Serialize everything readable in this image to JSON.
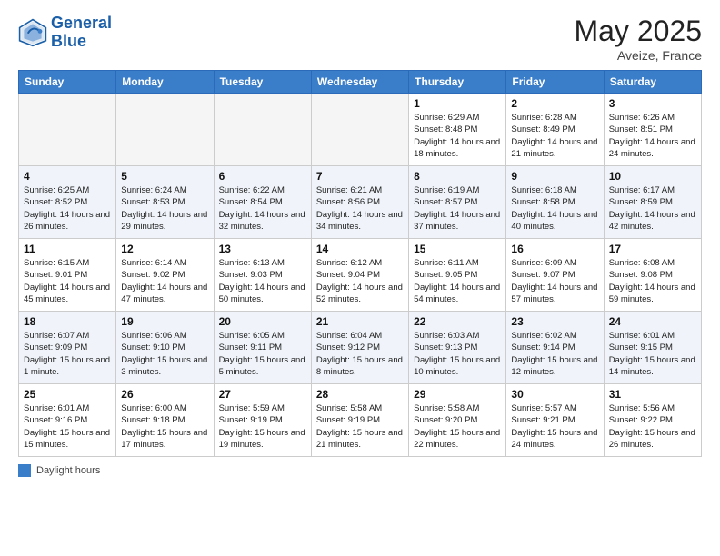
{
  "header": {
    "logo_line1": "General",
    "logo_line2": "Blue",
    "month_title": "May 2025",
    "location": "Aveize, France"
  },
  "days_of_week": [
    "Sunday",
    "Monday",
    "Tuesday",
    "Wednesday",
    "Thursday",
    "Friday",
    "Saturday"
  ],
  "weeks": [
    [
      {
        "day": "",
        "info": ""
      },
      {
        "day": "",
        "info": ""
      },
      {
        "day": "",
        "info": ""
      },
      {
        "day": "",
        "info": ""
      },
      {
        "day": "1",
        "info": "Sunrise: 6:29 AM\nSunset: 8:48 PM\nDaylight: 14 hours and 18 minutes."
      },
      {
        "day": "2",
        "info": "Sunrise: 6:28 AM\nSunset: 8:49 PM\nDaylight: 14 hours and 21 minutes."
      },
      {
        "day": "3",
        "info": "Sunrise: 6:26 AM\nSunset: 8:51 PM\nDaylight: 14 hours and 24 minutes."
      }
    ],
    [
      {
        "day": "4",
        "info": "Sunrise: 6:25 AM\nSunset: 8:52 PM\nDaylight: 14 hours and 26 minutes."
      },
      {
        "day": "5",
        "info": "Sunrise: 6:24 AM\nSunset: 8:53 PM\nDaylight: 14 hours and 29 minutes."
      },
      {
        "day": "6",
        "info": "Sunrise: 6:22 AM\nSunset: 8:54 PM\nDaylight: 14 hours and 32 minutes."
      },
      {
        "day": "7",
        "info": "Sunrise: 6:21 AM\nSunset: 8:56 PM\nDaylight: 14 hours and 34 minutes."
      },
      {
        "day": "8",
        "info": "Sunrise: 6:19 AM\nSunset: 8:57 PM\nDaylight: 14 hours and 37 minutes."
      },
      {
        "day": "9",
        "info": "Sunrise: 6:18 AM\nSunset: 8:58 PM\nDaylight: 14 hours and 40 minutes."
      },
      {
        "day": "10",
        "info": "Sunrise: 6:17 AM\nSunset: 8:59 PM\nDaylight: 14 hours and 42 minutes."
      }
    ],
    [
      {
        "day": "11",
        "info": "Sunrise: 6:15 AM\nSunset: 9:01 PM\nDaylight: 14 hours and 45 minutes."
      },
      {
        "day": "12",
        "info": "Sunrise: 6:14 AM\nSunset: 9:02 PM\nDaylight: 14 hours and 47 minutes."
      },
      {
        "day": "13",
        "info": "Sunrise: 6:13 AM\nSunset: 9:03 PM\nDaylight: 14 hours and 50 minutes."
      },
      {
        "day": "14",
        "info": "Sunrise: 6:12 AM\nSunset: 9:04 PM\nDaylight: 14 hours and 52 minutes."
      },
      {
        "day": "15",
        "info": "Sunrise: 6:11 AM\nSunset: 9:05 PM\nDaylight: 14 hours and 54 minutes."
      },
      {
        "day": "16",
        "info": "Sunrise: 6:09 AM\nSunset: 9:07 PM\nDaylight: 14 hours and 57 minutes."
      },
      {
        "day": "17",
        "info": "Sunrise: 6:08 AM\nSunset: 9:08 PM\nDaylight: 14 hours and 59 minutes."
      }
    ],
    [
      {
        "day": "18",
        "info": "Sunrise: 6:07 AM\nSunset: 9:09 PM\nDaylight: 15 hours and 1 minute."
      },
      {
        "day": "19",
        "info": "Sunrise: 6:06 AM\nSunset: 9:10 PM\nDaylight: 15 hours and 3 minutes."
      },
      {
        "day": "20",
        "info": "Sunrise: 6:05 AM\nSunset: 9:11 PM\nDaylight: 15 hours and 5 minutes."
      },
      {
        "day": "21",
        "info": "Sunrise: 6:04 AM\nSunset: 9:12 PM\nDaylight: 15 hours and 8 minutes."
      },
      {
        "day": "22",
        "info": "Sunrise: 6:03 AM\nSunset: 9:13 PM\nDaylight: 15 hours and 10 minutes."
      },
      {
        "day": "23",
        "info": "Sunrise: 6:02 AM\nSunset: 9:14 PM\nDaylight: 15 hours and 12 minutes."
      },
      {
        "day": "24",
        "info": "Sunrise: 6:01 AM\nSunset: 9:15 PM\nDaylight: 15 hours and 14 minutes."
      }
    ],
    [
      {
        "day": "25",
        "info": "Sunrise: 6:01 AM\nSunset: 9:16 PM\nDaylight: 15 hours and 15 minutes."
      },
      {
        "day": "26",
        "info": "Sunrise: 6:00 AM\nSunset: 9:18 PM\nDaylight: 15 hours and 17 minutes."
      },
      {
        "day": "27",
        "info": "Sunrise: 5:59 AM\nSunset: 9:19 PM\nDaylight: 15 hours and 19 minutes."
      },
      {
        "day": "28",
        "info": "Sunrise: 5:58 AM\nSunset: 9:19 PM\nDaylight: 15 hours and 21 minutes."
      },
      {
        "day": "29",
        "info": "Sunrise: 5:58 AM\nSunset: 9:20 PM\nDaylight: 15 hours and 22 minutes."
      },
      {
        "day": "30",
        "info": "Sunrise: 5:57 AM\nSunset: 9:21 PM\nDaylight: 15 hours and 24 minutes."
      },
      {
        "day": "31",
        "info": "Sunrise: 5:56 AM\nSunset: 9:22 PM\nDaylight: 15 hours and 26 minutes."
      }
    ]
  ],
  "footer": {
    "legend_label": "Daylight hours"
  }
}
